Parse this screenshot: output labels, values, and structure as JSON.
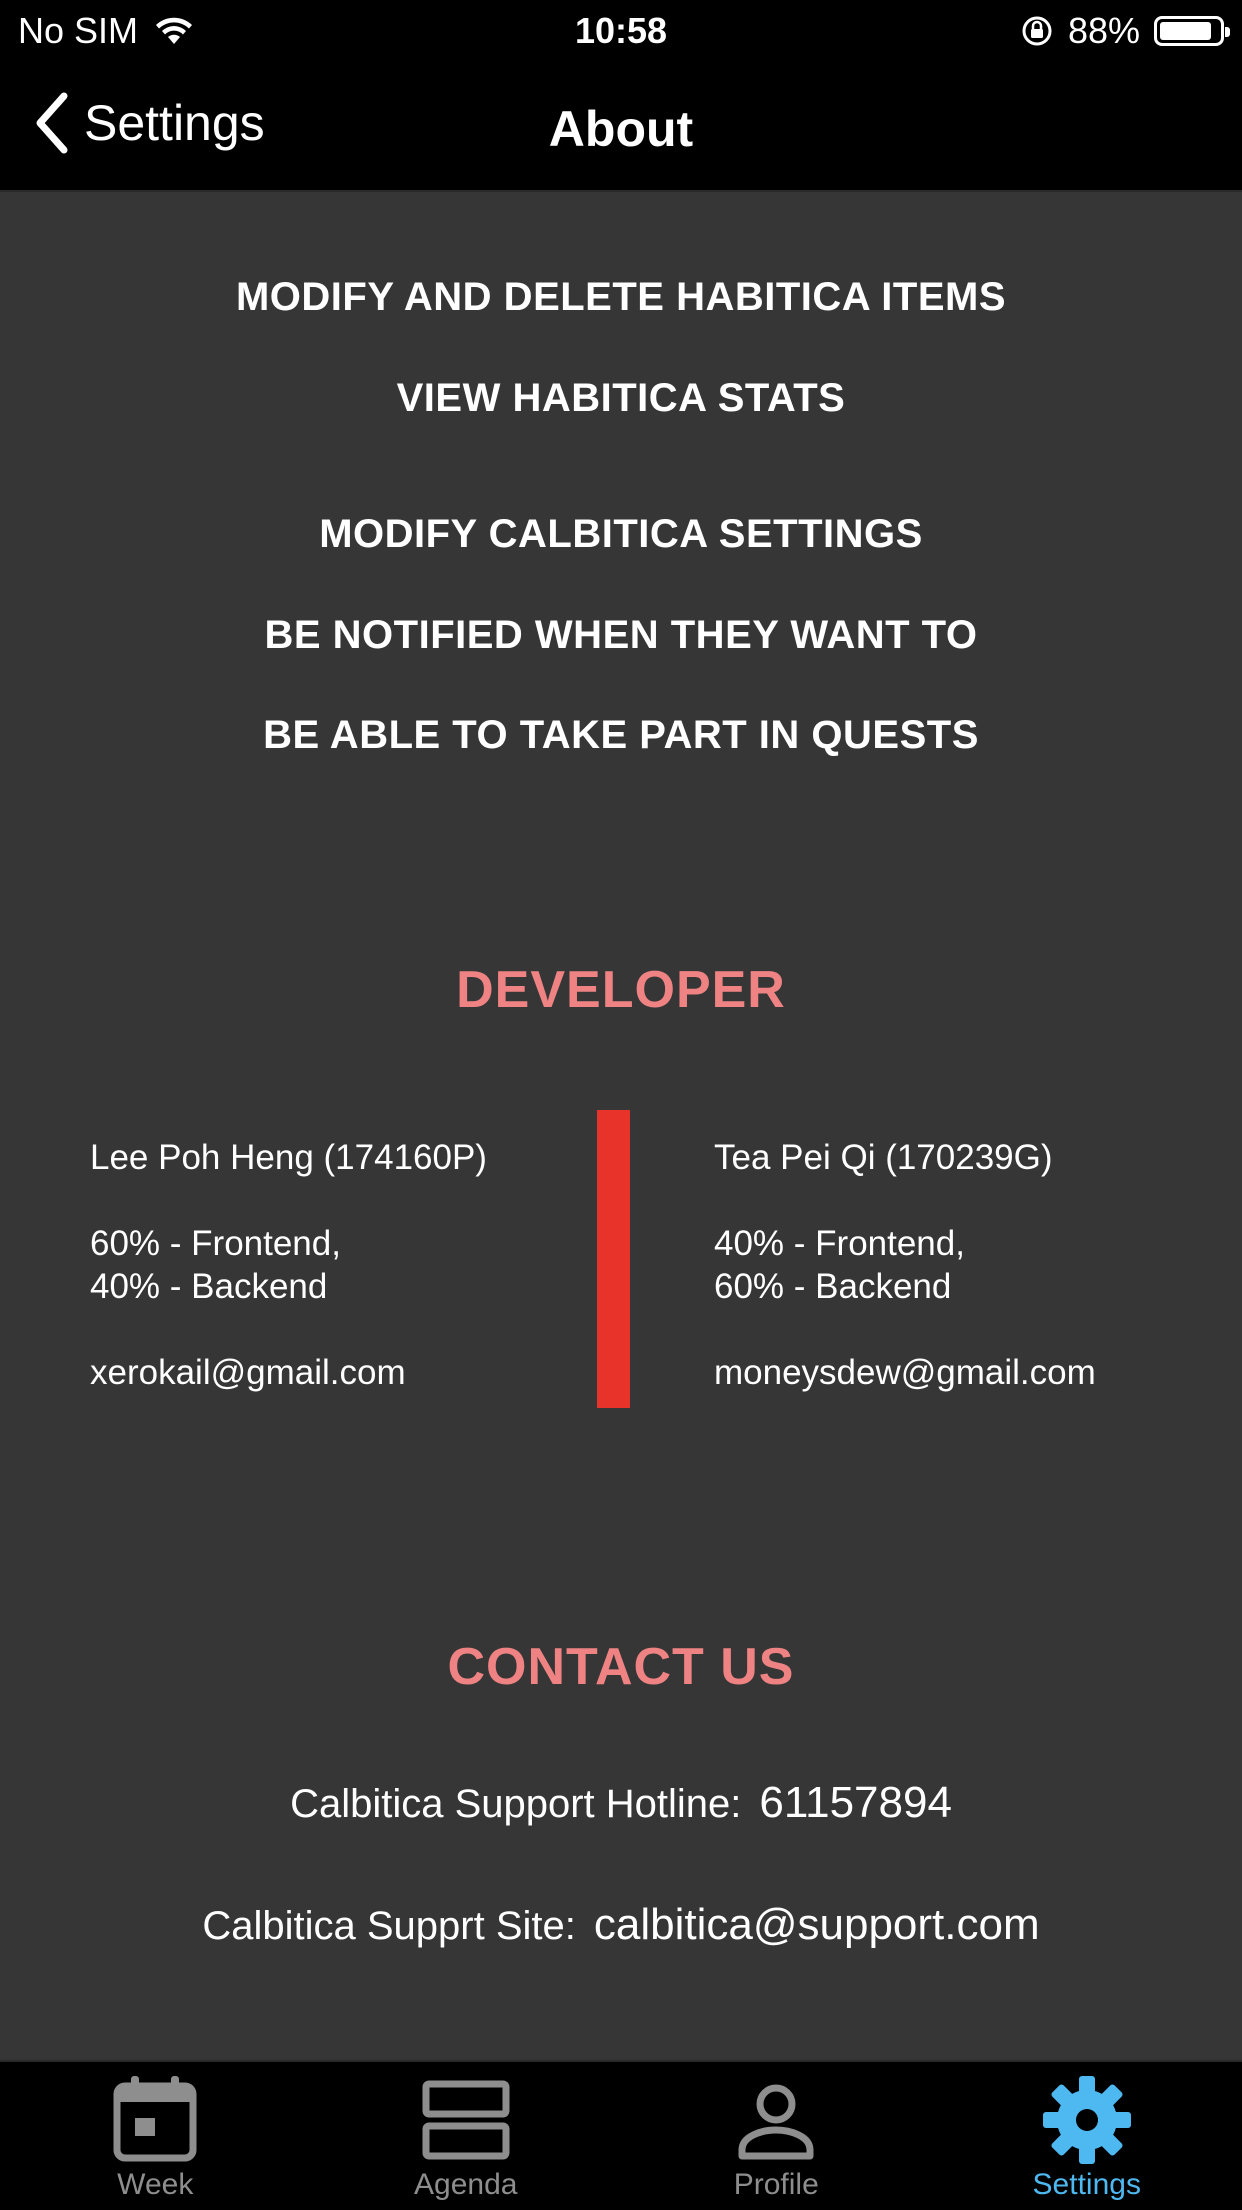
{
  "status": {
    "carrier": "No SIM",
    "time": "10:58",
    "battery": "88%",
    "battery_level": 0.88
  },
  "nav": {
    "back_label": "Settings",
    "title": "About"
  },
  "permissions": [
    "MODIFY AND DELETE HABITICA ITEMS",
    "VIEW HABITICA STATS",
    "MODIFY CALBITICA SETTINGS",
    "BE NOTIFIED WHEN THEY WANT TO",
    "BE ABLE TO TAKE PART IN QUESTS"
  ],
  "developer": {
    "heading": "DEVELOPER",
    "people": [
      {
        "name": "Lee Poh Heng (174160P)",
        "frontend": "60% - Frontend,",
        "backend": "40% - Backend",
        "email": "xerokail@gmail.com"
      },
      {
        "name": "Tea Pei Qi (170239G)",
        "frontend": "40% - Frontend,",
        "backend": "60% - Backend",
        "email": "moneysdew@gmail.com"
      }
    ]
  },
  "contact": {
    "heading": "CONTACT US",
    "hotline_label": "Calbitica Support Hotline:",
    "hotline_value": "61157894",
    "site_label": "Calbitica Supprt Site:",
    "site_value": "calbitica@support.com"
  },
  "tabs": [
    {
      "label": "Week",
      "icon": "calendar-icon",
      "active": false
    },
    {
      "label": "Agenda",
      "icon": "agenda-icon",
      "active": false
    },
    {
      "label": "Profile",
      "icon": "person-icon",
      "active": false
    },
    {
      "label": "Settings",
      "icon": "gear-icon",
      "active": true
    }
  ],
  "colors": {
    "background": "#363636",
    "accent_heading": "#ef8383",
    "divider": "#e8332a",
    "tab_active": "#4eb8f0",
    "tab_inactive": "#8e8e8e"
  }
}
